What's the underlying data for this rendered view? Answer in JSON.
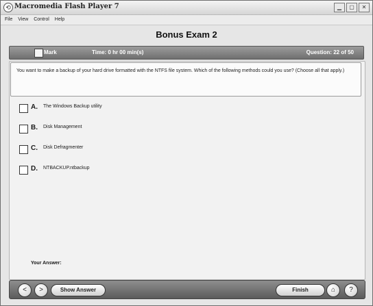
{
  "window": {
    "title": "Macromedia Flash Player 7",
    "icon": "flash-player-icon",
    "controls": [
      "minimize-icon",
      "maximize-icon",
      "close-icon"
    ]
  },
  "menu": [
    "File",
    "View",
    "Control",
    "Help"
  ],
  "exam": {
    "title": "Bonus Exam 2",
    "mark_label": "Mark",
    "time_label": "Time: 0 hr 00 min(s)",
    "question_label": "Question:",
    "question_count": "22 of 50"
  },
  "question": {
    "text": "You want to make a backup of your hard drive formatted with the NTFS file system. Which of the following methods could you use? (Choose all that apply.)"
  },
  "options": [
    {
      "letter": "A.",
      "text": "The Windows Backup utility"
    },
    {
      "letter": "B.",
      "text": "Disk Management"
    },
    {
      "letter": "C.",
      "text": "Disk Defragmenter"
    },
    {
      "letter": "D.",
      "text": "NTBACKUP.ntbackup"
    }
  ],
  "answer_label": "Your Answer:",
  "toolbar": {
    "show_answer": "Show Answer",
    "finish": "Finish",
    "prev_icon": "<",
    "next_icon": ">",
    "home_icon": "⌂",
    "help_icon": "?"
  }
}
